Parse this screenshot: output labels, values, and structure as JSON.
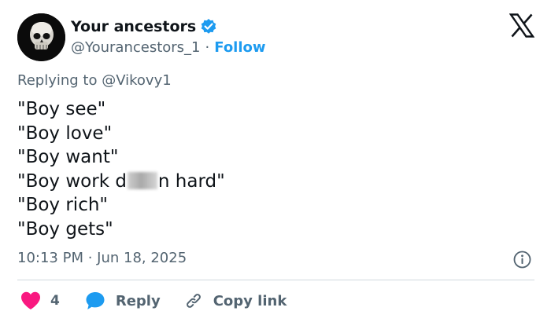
{
  "author": {
    "display_name": "Your ancestors",
    "handle": "@Yourancestors_1",
    "separator": "·",
    "follow_label": "Follow",
    "verified": true,
    "avatar": "skull-avatar"
  },
  "platform_icon": "x-logo-icon",
  "reply_to": "Replying to @Vikovy1",
  "tweet": {
    "lines": [
      "\"Boy see\"",
      "\"Boy love\"",
      "\"Boy want\"",
      {
        "before": "\"Boy work d",
        "after": "n hard\""
      },
      "\"Boy rich\"",
      "\"Boy gets\""
    ]
  },
  "timestamp": "10:13 PM · Jun 18, 2025",
  "actions": {
    "like_count": "4",
    "reply_label": "Reply",
    "copy_label": "Copy link"
  },
  "colors": {
    "accent": "#1d9bf0",
    "like": "#f91880",
    "secondary_text": "#536471",
    "divider": "#cfd9de"
  }
}
